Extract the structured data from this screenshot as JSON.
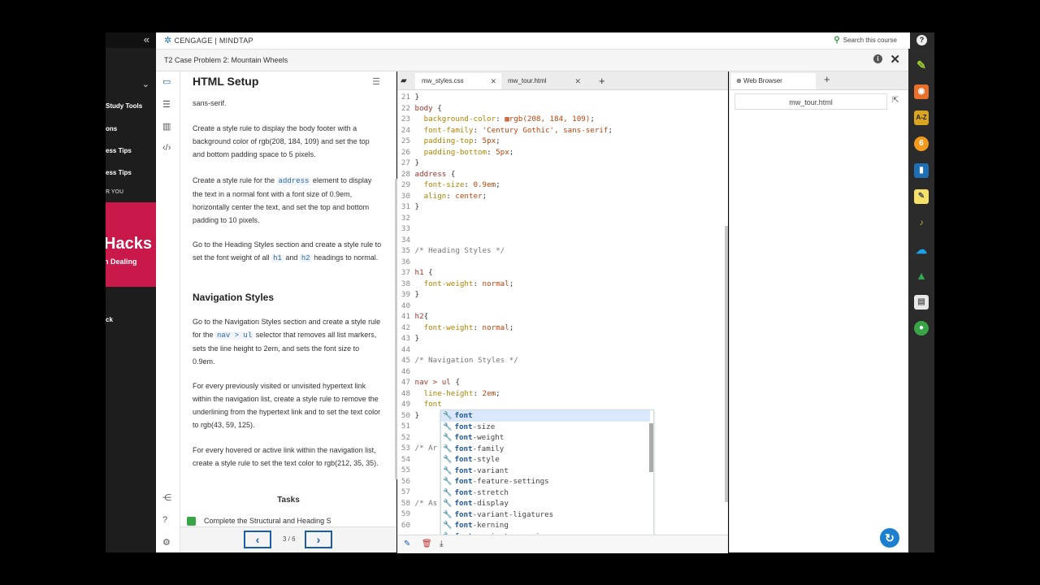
{
  "sidebar": {
    "collapse_icon": "«",
    "items": [
      "Study Tools",
      "ons",
      "ess Tips",
      "ess Tips",
      "R YOU",
      "ck"
    ],
    "promo_big": "Hacks",
    "promo_small": "n Dealing"
  },
  "header": {
    "brand": "CENGAGE | MINDTAP",
    "search": "Search this course"
  },
  "titlebar": {
    "title": "T2 Case Problem 2: Mountain Wheels"
  },
  "reader": {
    "heading": "HTML Setup",
    "p0": "sans-serif.",
    "p1": "Create a style rule to display the body footer with a background color of rgb(208, 184, 109) and set the top and bottom padding space to 5 pixels.",
    "p2a": "Create a style rule for the ",
    "p2code": "address",
    "p2b": " element to display the text in a normal font with a font size of 0.9em, horizontally center the text, and set the top and bottom padding to 10 pixels.",
    "p3a": "Go to the Heading Styles section and create a style rule to set the font weight of all ",
    "p3code1": "h1",
    "p3and": " and ",
    "p3code2": "h2",
    "p3b": " headings to normal.",
    "h2": "Navigation Styles",
    "p4a": "Go to the Navigation Styles section and create a style rule for the ",
    "p4code": "nav > ul",
    "p4b": " selector that removes all list markers, sets the line height to 2em, and sets the font size to 0.9em.",
    "p5": "For every previously visited or unvisited hypertext link within the navigation list, create a style rule to remove the underlining from the hypertext link and to set the text color to rgb(43, 59, 125).",
    "p6": "For every hovered or active link within the navigation list, create a style rule to set the text color to rgb(212, 35, 35).",
    "tasks": "Tasks",
    "task1": "Complete the Structural and Heading S",
    "page": "3 / 6"
  },
  "editor": {
    "tab1": "mw_styles.css",
    "tab2": "mw_tour.html",
    "lines": [
      {
        "n": "21",
        "t": "}"
      },
      {
        "n": "22",
        "t": "body {"
      },
      {
        "n": "23",
        "t": "  background-color: ▦rgb(208, 184, 109);"
      },
      {
        "n": "24",
        "t": "  font-family: 'Century Gothic', sans-serif;"
      },
      {
        "n": "25",
        "t": "  padding-top: 5px;"
      },
      {
        "n": "26",
        "t": "  padding-bottom: 5px;"
      },
      {
        "n": "27",
        "t": "}"
      },
      {
        "n": "28",
        "t": "address {"
      },
      {
        "n": "29",
        "t": "  font-size: 0.9em;"
      },
      {
        "n": "30",
        "t": "  align: center;"
      },
      {
        "n": "31",
        "t": "}"
      },
      {
        "n": "32",
        "t": ""
      },
      {
        "n": "33",
        "t": ""
      },
      {
        "n": "34",
        "t": ""
      },
      {
        "n": "35",
        "t": "/* Heading Styles */"
      },
      {
        "n": "36",
        "t": ""
      },
      {
        "n": "37",
        "t": "h1 {"
      },
      {
        "n": "38",
        "t": "  font-weight: normal;"
      },
      {
        "n": "39",
        "t": "}"
      },
      {
        "n": "40",
        "t": ""
      },
      {
        "n": "41",
        "t": "h2{"
      },
      {
        "n": "42",
        "t": "  font-weight: normal;"
      },
      {
        "n": "43",
        "t": "}"
      },
      {
        "n": "44",
        "t": ""
      },
      {
        "n": "45",
        "t": "/* Navigation Styles */"
      },
      {
        "n": "46",
        "t": ""
      },
      {
        "n": "47",
        "t": "nav > ul {"
      },
      {
        "n": "48",
        "t": "  line-height: 2em;"
      },
      {
        "n": "49",
        "t": "  font"
      },
      {
        "n": "50",
        "t": "}"
      },
      {
        "n": "51",
        "t": ""
      },
      {
        "n": "52",
        "t": ""
      },
      {
        "n": "53",
        "t": "/* Ar"
      },
      {
        "n": "54",
        "t": ""
      },
      {
        "n": "55",
        "t": ""
      },
      {
        "n": "56",
        "t": ""
      },
      {
        "n": "57",
        "t": ""
      },
      {
        "n": "58",
        "t": "/* As"
      },
      {
        "n": "59",
        "t": ""
      },
      {
        "n": "60",
        "t": ""
      }
    ],
    "autocomplete": [
      "font",
      "font-size",
      "font-weight",
      "font-family",
      "font-style",
      "font-variant",
      "font-feature-settings",
      "font-stretch",
      "font-display",
      "font-variant-ligatures",
      "font-kerning",
      "font-variant-numeric"
    ],
    "prefix": "font"
  },
  "browser": {
    "tab": "Web Browser",
    "address": "mw_tour.html"
  },
  "colors": {
    "accent": "#1a5ea8",
    "promo": "#c8194a",
    "task_check": "#3aa547"
  }
}
